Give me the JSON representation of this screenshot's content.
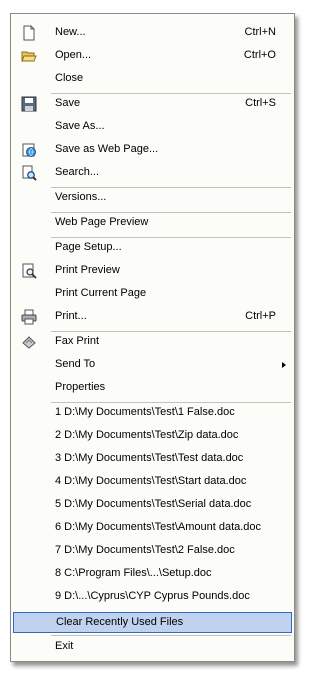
{
  "menu": {
    "new": {
      "label": "New...",
      "shortcut": "Ctrl+N"
    },
    "open": {
      "label": "Open...",
      "shortcut": "Ctrl+O"
    },
    "close": {
      "label": "Close"
    },
    "save": {
      "label": "Save",
      "shortcut": "Ctrl+S"
    },
    "save_as": {
      "label": "Save As..."
    },
    "save_web": {
      "label": "Save as Web Page..."
    },
    "search": {
      "label": "Search..."
    },
    "versions": {
      "label": "Versions..."
    },
    "web_preview": {
      "label": "Web Page Preview"
    },
    "page_setup": {
      "label": "Page Setup..."
    },
    "print_preview": {
      "label": "Print Preview"
    },
    "print_current": {
      "label": "Print Current Page"
    },
    "print": {
      "label": "Print...",
      "shortcut": "Ctrl+P"
    },
    "fax_print": {
      "label": "Fax Print"
    },
    "send_to": {
      "label": "Send To"
    },
    "properties": {
      "label": "Properties"
    },
    "recent_files": [
      "1 D:\\My Documents\\Test\\1  False.doc",
      "2 D:\\My Documents\\Test\\Zip data.doc",
      "3 D:\\My Documents\\Test\\Test data.doc",
      "4 D:\\My Documents\\Test\\Start data.doc",
      "5 D:\\My Documents\\Test\\Serial data.doc",
      "6 D:\\My Documents\\Test\\Amount data.doc",
      "7 D:\\My Documents\\Test\\2  False.doc",
      "8 C:\\Program Files\\...\\Setup.doc",
      "9 D:\\...\\Cyprus\\CYP Cyprus Pounds.doc"
    ],
    "clear_recent": {
      "label": "Clear Recently Used Files"
    },
    "exit": {
      "label": "Exit"
    }
  },
  "colors": {
    "highlight_fill": "#c1d2ee",
    "highlight_border": "#316ac5",
    "menu_background": "#fcfcf9",
    "separator": "#c5c2b8"
  },
  "icons": {
    "new": "blank-page-icon",
    "open": "open-folder-icon",
    "save": "floppy-disk-icon",
    "save_web": "web-page-save-icon",
    "search": "search-document-icon",
    "print_preview": "print-preview-icon",
    "print": "printer-icon",
    "fax_print": "fax-icon"
  }
}
